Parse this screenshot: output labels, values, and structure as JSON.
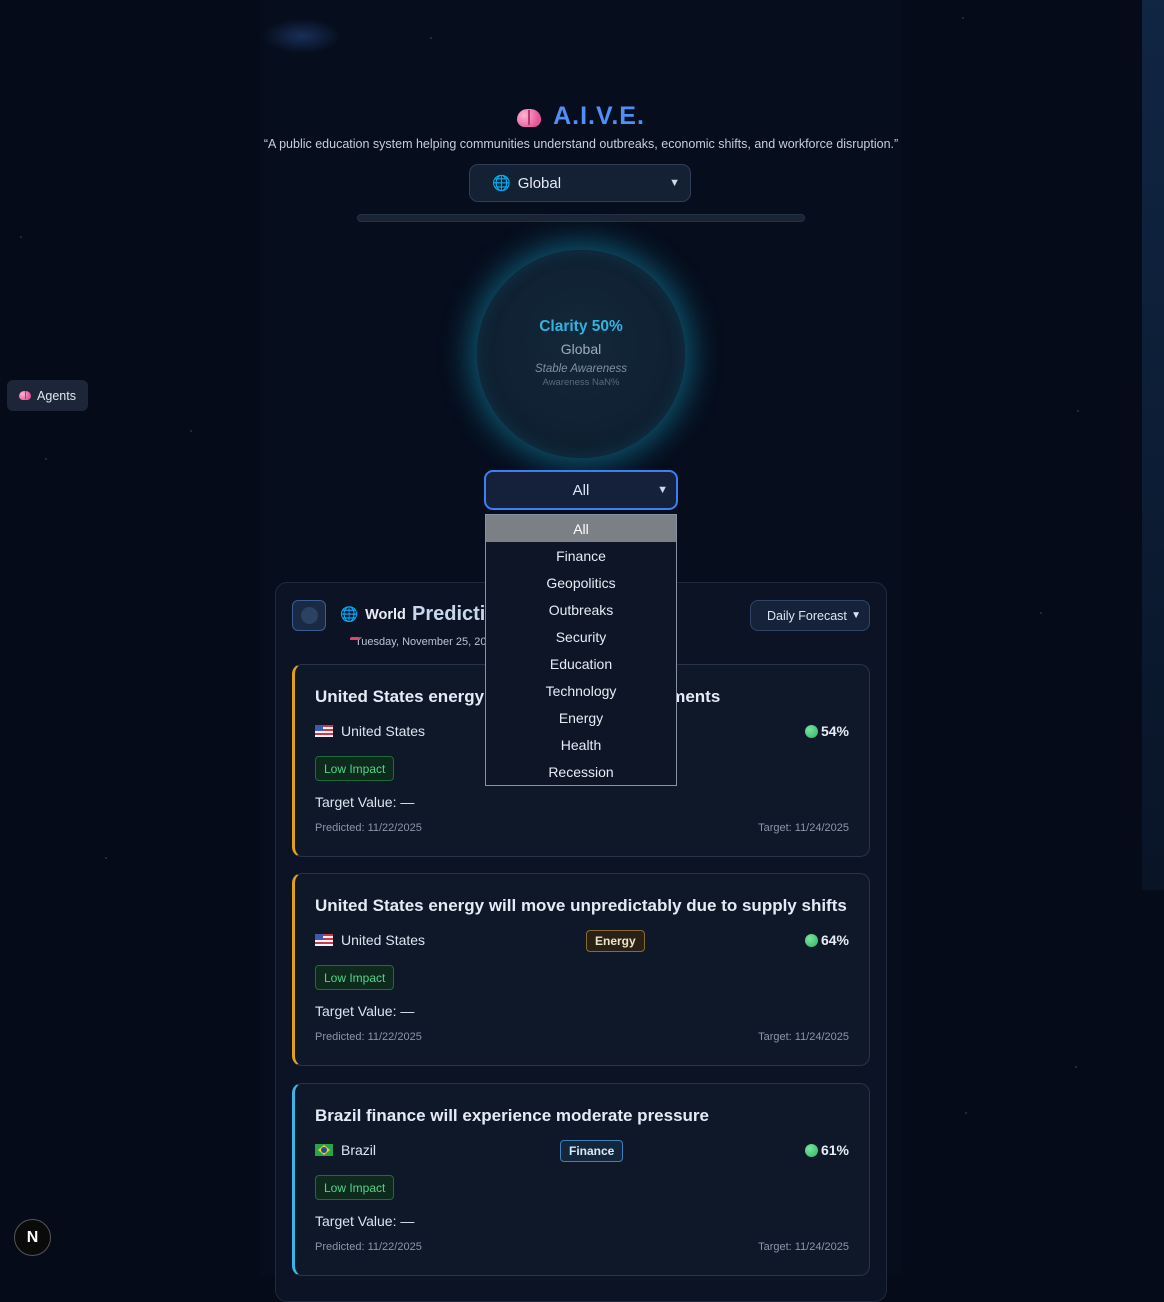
{
  "header": {
    "title": "A.I.V.E.",
    "tagline": "“A public education system helping communities understand outbreaks, economic shifts, and workforce disruption.”"
  },
  "region_select": {
    "value": "Global",
    "icon": "globe-icon"
  },
  "clarity_progress": 0,
  "orb": {
    "clarity": "Clarity 50%",
    "region": "Global",
    "state": "Stable Awareness",
    "awareness": "Awareness NaN%"
  },
  "agents_button": {
    "label": "Agents"
  },
  "category_select": {
    "value": "All",
    "options": [
      "All",
      "Finance",
      "Geopolitics",
      "Outbreaks",
      "Security",
      "Education",
      "Technology",
      "Energy",
      "Health",
      "Recession"
    ]
  },
  "panel": {
    "world_label": "World",
    "title": "Predictions",
    "date": "Tuesday, November 25, 2025",
    "forecast_select": "Daily Forecast"
  },
  "predictions": [
    {
      "title": "United States energy will face market adjustments",
      "country": "United States",
      "category": "",
      "confidence": "54%",
      "impact": "Low Impact",
      "target_value": "Target Value: —",
      "predicted": "Predicted: 11/22/2025",
      "target": "Target: 11/24/2025",
      "accent": "#e0a01e"
    },
    {
      "title": "United States energy will move unpredictably due to supply shifts",
      "country": "United States",
      "category": "Energy",
      "confidence": "64%",
      "impact": "Low Impact",
      "target_value": "Target Value: —",
      "predicted": "Predicted: 11/22/2025",
      "target": "Target: 11/24/2025",
      "accent": "#e0a01e"
    },
    {
      "title": "Brazil finance will experience moderate pressure",
      "country": "Brazil",
      "category": "Finance",
      "confidence": "61%",
      "impact": "Low Impact",
      "target_value": "Target Value: —",
      "predicted": "Predicted: 11/22/2025",
      "target": "Target: 11/24/2025",
      "accent": "#3fb3e6"
    }
  ],
  "next_badge": "N"
}
